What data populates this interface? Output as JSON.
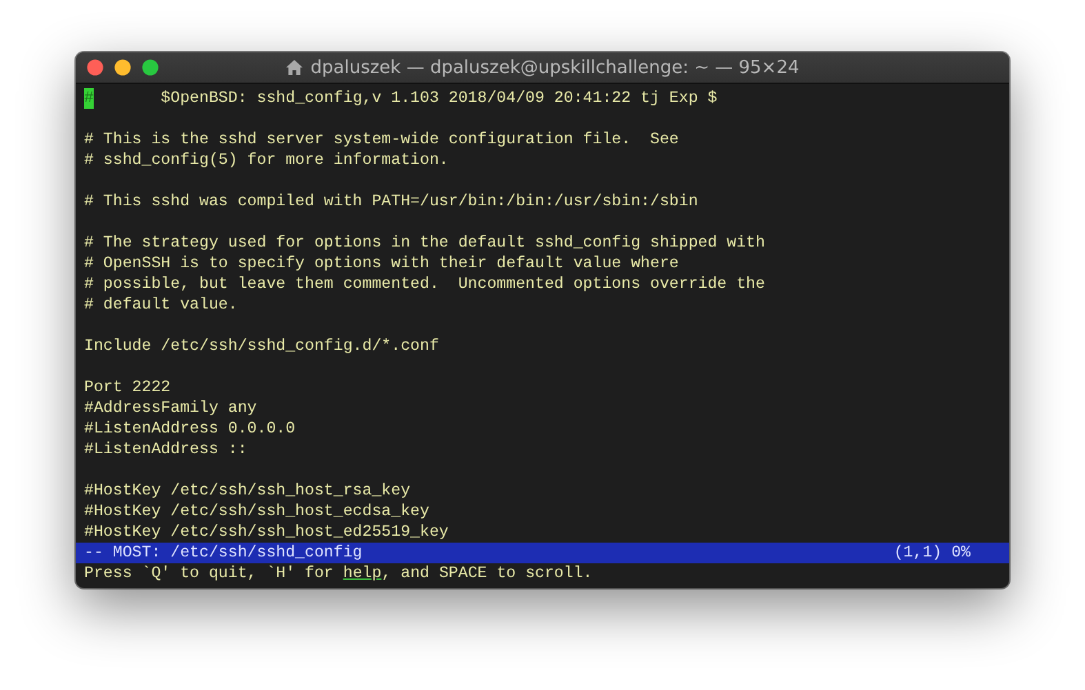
{
  "window": {
    "title": "dpaluszek — dpaluszek@upskillchallenge: ~ — 95×24"
  },
  "cursor": {
    "char": "#"
  },
  "lines": [
    {
      "kind": "text",
      "text": "       $OpenBSD: sshd_config,v 1.103 2018/04/09 20:41:22 tj Exp $"
    },
    {
      "kind": "blank"
    },
    {
      "kind": "text",
      "text": "# This is the sshd server system-wide configuration file.  See"
    },
    {
      "kind": "text",
      "text": "# sshd_config(5) for more information."
    },
    {
      "kind": "blank"
    },
    {
      "kind": "text",
      "text": "# This sshd was compiled with PATH=/usr/bin:/bin:/usr/sbin:/sbin"
    },
    {
      "kind": "blank"
    },
    {
      "kind": "text",
      "text": "# The strategy used for options in the default sshd_config shipped with"
    },
    {
      "kind": "text",
      "text": "# OpenSSH is to specify options with their default value where"
    },
    {
      "kind": "text",
      "text": "# possible, but leave them commented.  Uncommented options override the"
    },
    {
      "kind": "text",
      "text": "# default value."
    },
    {
      "kind": "blank"
    },
    {
      "kind": "text",
      "text": "Include /etc/ssh/sshd_config.d/*.conf"
    },
    {
      "kind": "blank"
    },
    {
      "kind": "text",
      "text": "Port 2222"
    },
    {
      "kind": "text",
      "text": "#AddressFamily any"
    },
    {
      "kind": "text",
      "text": "#ListenAddress 0.0.0.0"
    },
    {
      "kind": "text",
      "text": "#ListenAddress ::"
    },
    {
      "kind": "blank"
    },
    {
      "kind": "text",
      "text": "#HostKey /etc/ssh/ssh_host_rsa_key"
    },
    {
      "kind": "text",
      "text": "#HostKey /etc/ssh/ssh_host_ecdsa_key"
    },
    {
      "kind": "text",
      "text": "#HostKey /etc/ssh/ssh_host_ed25519_key"
    }
  ],
  "status_bar": {
    "file": "-- MOST: /etc/ssh/sshd_config",
    "position": "(1,1) 0%"
  },
  "prompt": {
    "before": "Press `Q' to quit, `H' for ",
    "underlined": "help",
    "after": ", and SPACE to scroll."
  }
}
